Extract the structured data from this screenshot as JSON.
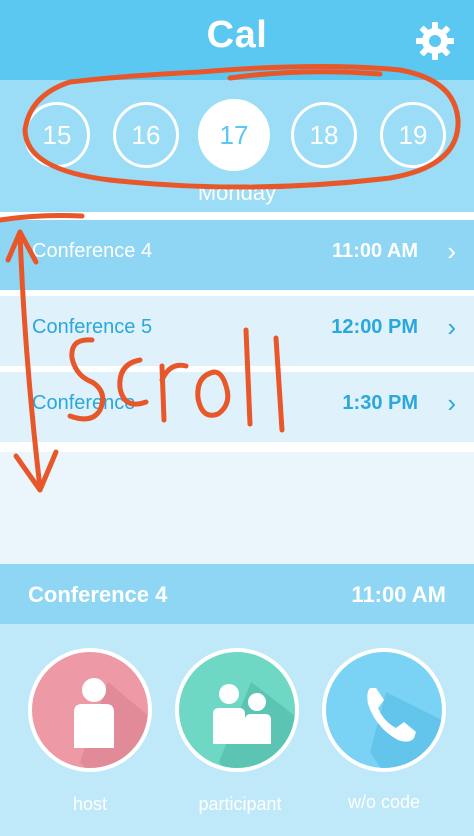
{
  "header": {
    "title": "Cal",
    "settings_icon": "gear-icon"
  },
  "dates": {
    "days": [
      "15",
      "16",
      "17",
      "18",
      "19"
    ],
    "selected": "17",
    "day_label": "Monday"
  },
  "events": [
    {
      "title": "Conference 4",
      "time": "11:00 AM",
      "selected": true
    },
    {
      "title": "Conference 5",
      "time": "12:00 PM",
      "selected": false
    },
    {
      "title": "Conference",
      "time": "1:30 PM",
      "selected": false
    }
  ],
  "current_event": {
    "title": "Conference 4",
    "time": "11:00 AM"
  },
  "actions": [
    {
      "label": "host",
      "icon": "person-icon",
      "color": "#ee9aa6"
    },
    {
      "label": "participant",
      "icon": "group-icon",
      "color": "#6fd8c4"
    },
    {
      "label": "w/o code",
      "icon": "phone-icon",
      "color": "#7ad3f5"
    }
  ],
  "annotation": {
    "text": "Scroll",
    "color": "#e8572a"
  },
  "colors": {
    "accent": "#5ac8f0",
    "row_text": "#2aa7dc"
  }
}
